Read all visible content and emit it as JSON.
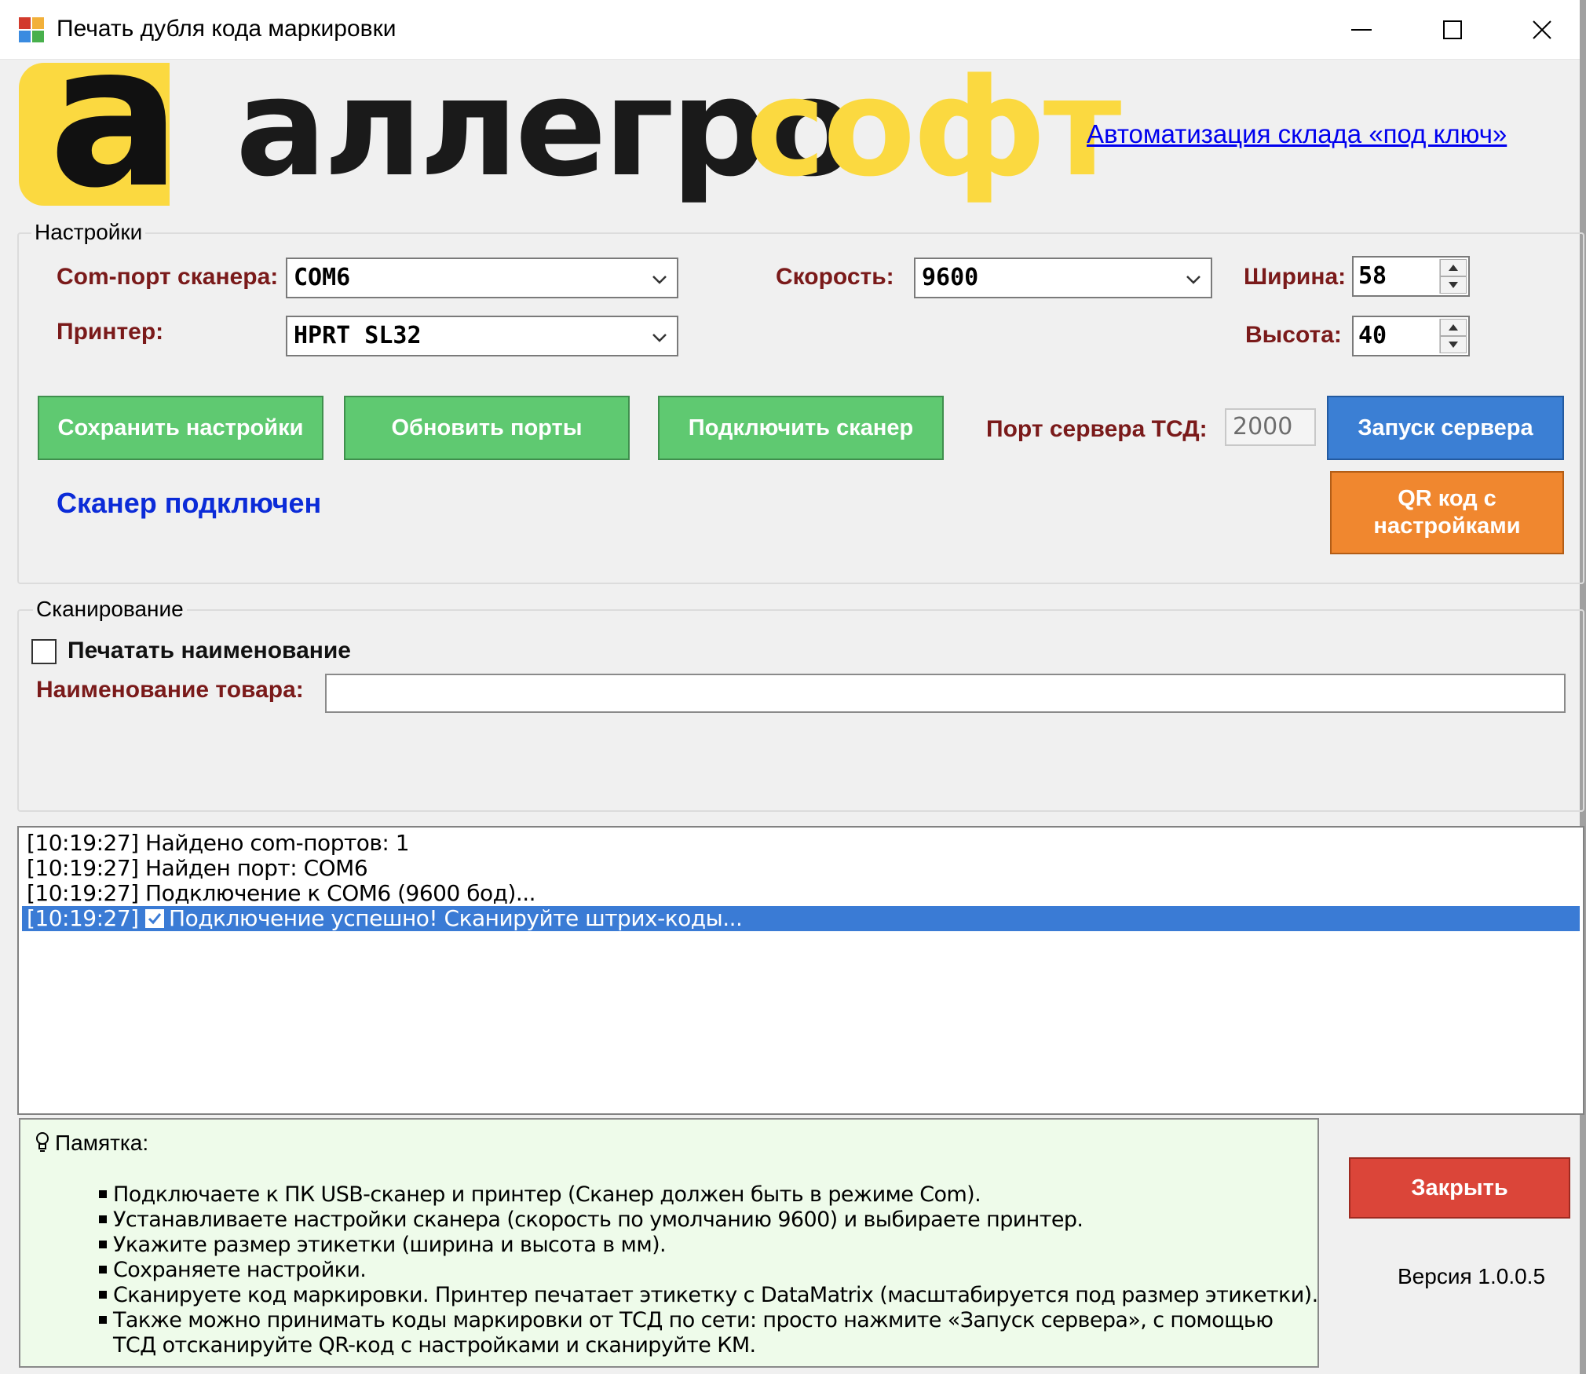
{
  "window": {
    "title": "Печать дубля кода маркировки"
  },
  "brand": {
    "logo_letter": "а",
    "name_part1": "аллегро",
    "name_part2": "софт",
    "promo_link": "Автоматизация склада «под ключ»",
    "colors": {
      "yellow": "#fbd940",
      "dark": "#1a1a1a"
    }
  },
  "settings": {
    "legend": "Настройки",
    "com_port_label": "Com-порт сканера:",
    "com_port_value": "COM6",
    "speed_label": "Скорость:",
    "speed_value": "9600",
    "width_label": "Ширина:",
    "width_value": "58",
    "printer_label": "Принтер:",
    "printer_value": "HPRT SL32",
    "height_label": "Высота:",
    "height_value": "40",
    "save_button": "Сохранить настройки",
    "refresh_button": "Обновить порты",
    "connect_button": "Подключить сканер",
    "server_port_label": "Порт сервера ТСД:",
    "server_port_value": "2000",
    "start_server_button": "Запуск сервера",
    "qr_button_line1": "QR код с",
    "qr_button_line2": "настройками",
    "scanner_status": "Сканер подключен"
  },
  "scanning": {
    "legend": "Сканирование",
    "print_name_label": "Печатать наименование",
    "print_name_checked": false,
    "product_name_label": "Наименование товара:",
    "product_name_value": ""
  },
  "log": {
    "rows": [
      {
        "time": "[10:19:27]",
        "text": "Найдено com-портов: 1"
      },
      {
        "time": "[10:19:27]",
        "text": "Найден порт: COM6"
      },
      {
        "time": "[10:19:27]",
        "text": "Подключение к COM6 (9600 бод)..."
      },
      {
        "time": "[10:19:27]",
        "text": "Подключение успешно! Сканируйте штрих-коды...",
        "selected": true,
        "icon": "checkmark-icon"
      }
    ]
  },
  "memo": {
    "title": "Памятка:",
    "icon": "lightbulb-icon",
    "items": [
      "Подключаете к ПК USB-сканер и принтер (Сканер должен быть в режиме Com).",
      "Устанавливаете настройки сканера (скорость по умолчанию 9600) и выбираете принтер.",
      "Укажите размер этикетки (ширина и высота в мм).",
      "Сохраняете настройки.",
      "Сканируете код маркировки. Принтер печатает этикетку с DataMatrix (масштабируется под размер этикетки).",
      "Также можно принимать коды маркировки от ТСД по сети: просто нажмите «Запуск сервера», с помощью",
      "ТСД отсканируйте QR-код с настройками и сканируйте КМ."
    ]
  },
  "footer": {
    "close_button": "Закрыть",
    "version": "Версия 1.0.0.5"
  },
  "colors": {
    "label_dark_red": "#7a1a1a",
    "status_blue": "#0b2bd8",
    "green_button": "#5fc971",
    "blue_button": "#3b7fd4",
    "orange_button": "#f0872f",
    "red_button": "#db4539",
    "selection": "#3a7bd5",
    "memo_bg": "#eefbea"
  }
}
